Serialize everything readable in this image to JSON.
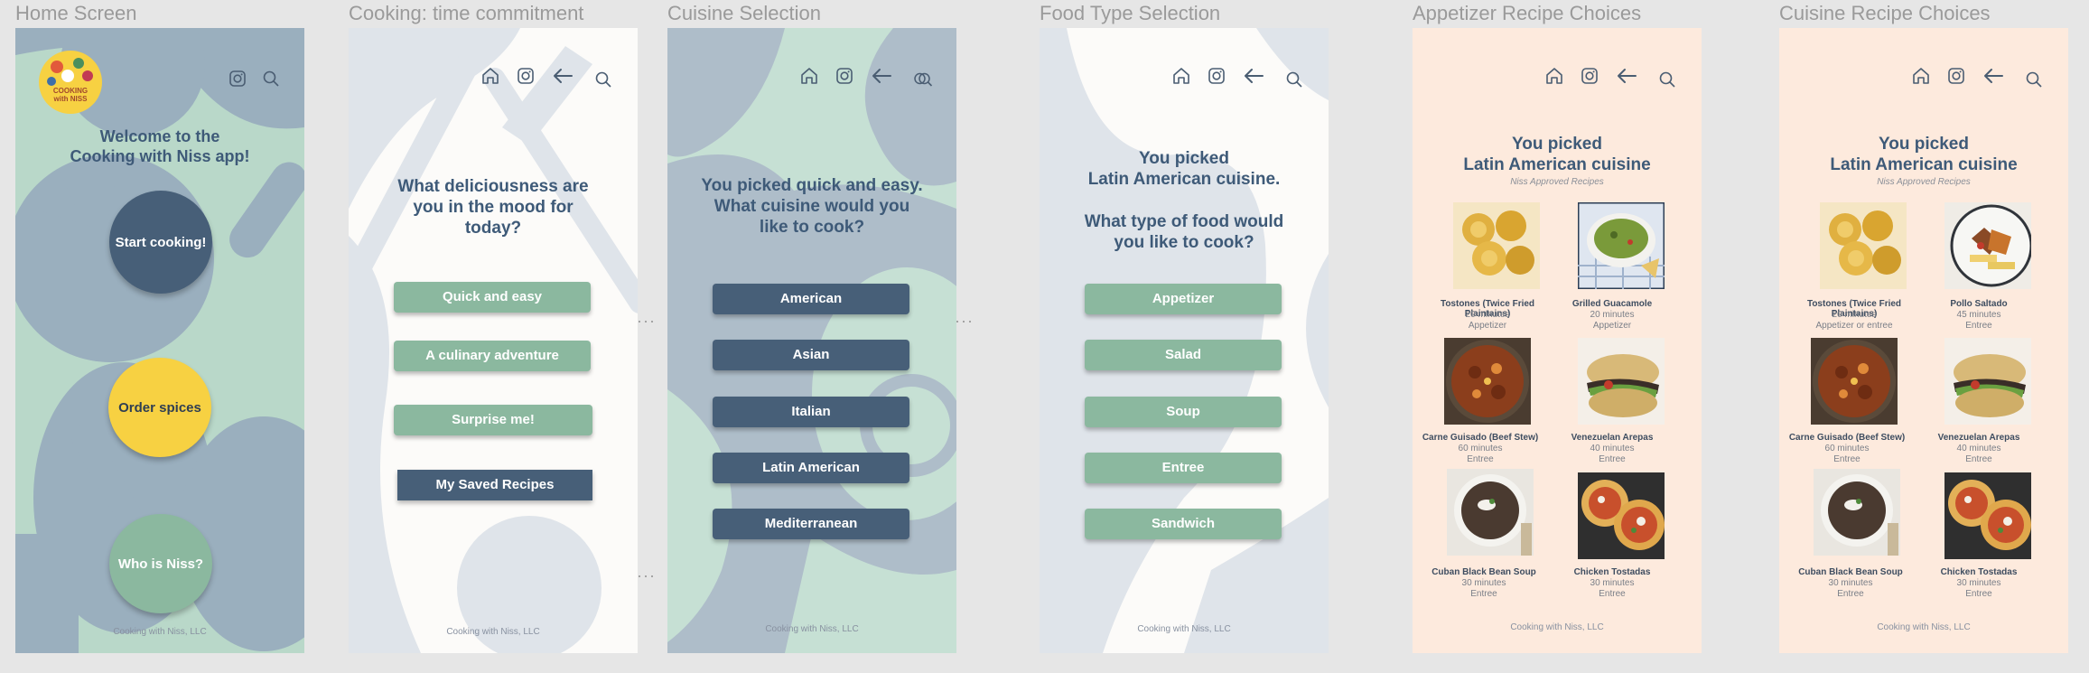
{
  "frames": {
    "home": {
      "title": "Home Screen",
      "welcome": "Welcome to the\nCooking with Niss app!",
      "logo_text": "COOKING\nwith NISS",
      "start": "Start cooking!",
      "order": "Order spices",
      "who": "Who is Niss?",
      "footer": "Cooking with Niss, LLC"
    },
    "time": {
      "title": "Cooking: time commitment",
      "question": "What deliciousness are\nyou in the mood for\ntoday?",
      "options": [
        "Quick and easy",
        "A culinary adventure",
        "Surprise me!"
      ],
      "saved": "My Saved Recipes",
      "footer": "Cooking with Niss, LLC"
    },
    "cuisine": {
      "title": "Cuisine Selection",
      "question": "You picked quick and easy.\nWhat cuisine would you\nlike to cook?",
      "options": [
        "American",
        "Asian",
        "Italian",
        "Latin American",
        "Mediterranean"
      ],
      "footer": "Cooking with Niss, LLC"
    },
    "food": {
      "title": "Food Type Selection",
      "question": "You picked\nLatin American cuisine.\n\nWhat type of food would\nyou like to cook?",
      "options": [
        "Appetizer",
        "Salad",
        "Soup",
        "Entree",
        "Sandwich"
      ],
      "footer": "Cooking with Niss, LLC"
    },
    "appetizer": {
      "title": "Appetizer Recipe Choices",
      "heading": "You picked\nLatin American cuisine",
      "subtitle": "Niss Approved Recipes",
      "recipes": [
        {
          "name": "Tostones (Twice Fried Plaintains)",
          "time": "20  minutes",
          "type": "Appetizer",
          "image": "tostones"
        },
        {
          "name": "Grilled Guacamole",
          "time": "20  minutes",
          "type": "Appetizer",
          "image": "guacamole"
        },
        {
          "name": "Carne Guisado (Beef Stew)",
          "time": "60  minutes",
          "type": "Entree",
          "image": "stew"
        },
        {
          "name": "Venezuelan Arepas",
          "time": "40  minutes",
          "type": "Entree",
          "image": "arepa"
        },
        {
          "name": "Cuban Black Bean Soup",
          "time": "30  minutes",
          "type": "Entree",
          "image": "soup"
        },
        {
          "name": "Chicken Tostadas",
          "time": "30  minutes",
          "type": "Entree",
          "image": "tostada"
        }
      ],
      "footer": "Cooking with Niss, LLC"
    },
    "cuisine_recipes": {
      "title": "Cuisine Recipe Choices",
      "heading": "You picked\nLatin American cuisine",
      "subtitle": "Niss Approved Recipes",
      "recipes": [
        {
          "name": "Tostones (Twice Fried Plaintains)",
          "time": "20  minutes",
          "type": "Appetizer or entree",
          "image": "tostones"
        },
        {
          "name": "Pollo Saltado",
          "time": "45  minutes",
          "type": "Entree",
          "image": "pollo"
        },
        {
          "name": "Carne Guisado (Beef Stew)",
          "time": "60  minutes",
          "type": "Entree",
          "image": "stew"
        },
        {
          "name": "Venezuelan Arepas",
          "time": "40  minutes",
          "type": "Entree",
          "image": "arepa"
        },
        {
          "name": "Cuban Black Bean Soup",
          "time": "30  minutes",
          "type": "Entree",
          "image": "soup"
        },
        {
          "name": "Chicken Tostadas",
          "time": "30  minutes",
          "type": "Entree",
          "image": "tostada"
        }
      ],
      "footer": "Cooking with Niss, LLC"
    }
  },
  "colors": {
    "navy": "#475f78",
    "green": "#8bb89f",
    "yellow": "#f7d142",
    "heading": "#3e5a78",
    "peach": "#fdeadd",
    "offwhite": "#fcfbf9"
  },
  "icons": [
    "home-icon",
    "instagram-icon",
    "back-arrow-icon",
    "search-icon"
  ]
}
